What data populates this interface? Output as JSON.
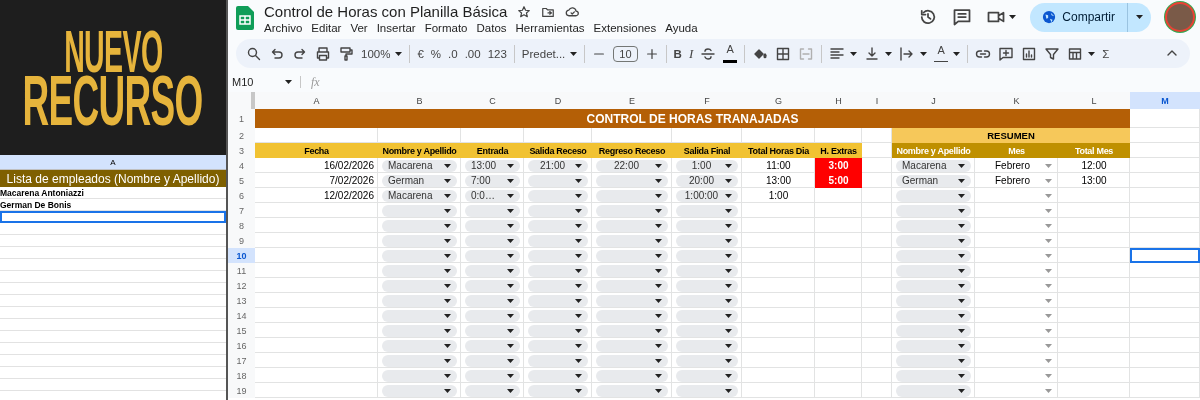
{
  "banner": {
    "lines": [
      "NUEVO",
      "RECURSO"
    ]
  },
  "employee_sheet": {
    "column": "A",
    "header": "Lista de empleados (Nombre y Apellido)",
    "rows": [
      {
        "name": "Macarena Antoniazzi",
        "selected": false
      },
      {
        "name": "German De Bonis",
        "selected": false
      },
      {
        "selected": true
      },
      {
        "selected": false
      },
      {
        "selected": false
      },
      {
        "selected": false
      },
      {
        "selected": false
      },
      {
        "selected": false
      },
      {
        "selected": false
      },
      {
        "selected": false
      },
      {
        "selected": false
      },
      {
        "selected": false
      },
      {
        "selected": false
      },
      {
        "selected": false
      },
      {
        "selected": false
      },
      {
        "selected": false
      },
      {
        "selected": false
      }
    ]
  },
  "document": {
    "title": "Control de Horas con Planilla Básica",
    "menu": [
      "Archivo",
      "Editar",
      "Ver",
      "Insertar",
      "Formato",
      "Datos",
      "Herramientas",
      "Extensiones",
      "Ayuda"
    ],
    "share_button": "Compartir"
  },
  "toolbar": {
    "zoom": "100%",
    "currency": "€",
    "percent": "%",
    "decrease_decimals": ".0",
    "increase_decimals": ".00",
    "number_format": "123",
    "font": "Predet...",
    "font_size": "10",
    "bold": "B",
    "italic": "I",
    "text_color": "A",
    "text_rotation": "A",
    "sum": "Σ"
  },
  "formula_bar": {
    "cell_ref": "M10",
    "fx": "fx"
  },
  "sheet": {
    "columns": [
      {
        "label": "A",
        "selected": false
      },
      {
        "label": "B",
        "selected": false
      },
      {
        "label": "C",
        "selected": false
      },
      {
        "label": "D",
        "selected": false
      },
      {
        "label": "E",
        "selected": false
      },
      {
        "label": "F",
        "selected": false
      },
      {
        "label": "G",
        "selected": false
      },
      {
        "label": "H",
        "selected": false
      },
      {
        "label": "I",
        "selected": false
      },
      {
        "label": "J",
        "selected": false
      },
      {
        "label": "K",
        "selected": false
      },
      {
        "label": "L",
        "selected": false
      },
      {
        "label": "M",
        "selected": true
      }
    ],
    "row_numbers": [
      {
        "label": "1",
        "selected": false
      },
      {
        "label": "2",
        "selected": false
      },
      {
        "label": "3",
        "selected": false
      },
      {
        "label": "4",
        "selected": false
      },
      {
        "label": "5",
        "selected": false
      },
      {
        "label": "6",
        "selected": false
      },
      {
        "label": "7",
        "selected": false
      },
      {
        "label": "8",
        "selected": false
      },
      {
        "label": "9",
        "selected": false
      },
      {
        "label": "10",
        "selected": true
      },
      {
        "label": "11",
        "selected": false
      },
      {
        "label": "12",
        "selected": false
      },
      {
        "label": "13",
        "selected": false
      },
      {
        "label": "14",
        "selected": false
      },
      {
        "label": "15",
        "selected": false
      },
      {
        "label": "16",
        "selected": false
      },
      {
        "label": "17",
        "selected": false
      },
      {
        "label": "18",
        "selected": false
      },
      {
        "label": "19",
        "selected": false
      }
    ],
    "title": "CONTROL DE HORAS TRANAJADAS",
    "summary_title": "RESUMEN",
    "headers": [
      "Fecha",
      "Nombre y Apellido",
      "Entrada",
      "Salida Receso",
      "Regreso Receso",
      "Salida Final",
      "Total Horas Dia",
      "H. Extras"
    ],
    "summary_headers": [
      "Nombre y Apellido",
      "Mes",
      "Total Mes"
    ],
    "rows": [
      {
        "fecha": "16/02/2026",
        "nombre": "Macarena",
        "entrada": "13:00",
        "salida_receso": "21:00",
        "regreso_receso": "22:00",
        "salida_final": "1:00",
        "total_horas": "11:00",
        "extras": "3:00",
        "extras_alert": true,
        "resumen_nombre": "Macarena",
        "resumen_mes": "Febrero",
        "resumen_total": "12:00"
      },
      {
        "fecha": "7/02/2026",
        "nombre": "German",
        "entrada": "7:00",
        "salida_final": "20:00",
        "total_horas": "13:00",
        "extras": "5:00",
        "extras_alert": true,
        "resumen_nombre": "German",
        "resumen_mes": "Febrero",
        "resumen_total": "13:00"
      },
      {
        "fecha": "12/02/2026",
        "nombre": "Macarena",
        "entrada": "0:0…",
        "salida_final": "1:00:00",
        "total_horas": "1:00",
        "extras_alert": false
      },
      {
        "extras_alert": false
      },
      {
        "extras_alert": false
      },
      {
        "extras_alert": false
      },
      {
        "extras_alert": false
      },
      {
        "extras_alert": false
      },
      {
        "extras_alert": false
      },
      {
        "extras_alert": false
      },
      {
        "extras_alert": false
      },
      {
        "extras_alert": false
      },
      {
        "extras_alert": false
      },
      {
        "extras_alert": false
      },
      {
        "extras_alert": false
      },
      {
        "extras_alert": false
      }
    ]
  }
}
